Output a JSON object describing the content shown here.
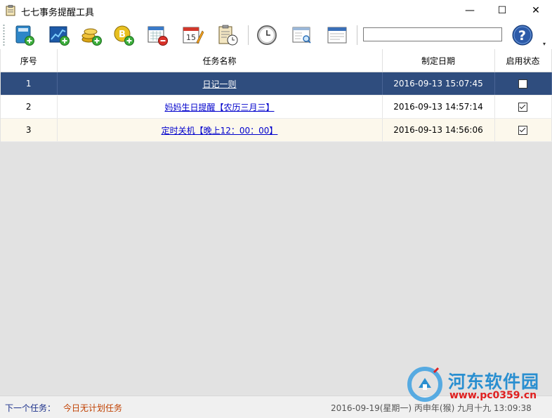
{
  "window": {
    "title": "七七事务提醒工具",
    "minimize_glyph": "—",
    "maximize_glyph": "☐",
    "close_glyph": "✕"
  },
  "toolbar": {
    "buttons": [
      {
        "icon": "add-notebook-icon"
      },
      {
        "icon": "add-chart-icon"
      },
      {
        "icon": "add-coins-icon"
      },
      {
        "icon": "add-bitcoin-icon"
      },
      {
        "icon": "remove-calendar-icon"
      },
      {
        "icon": "calendar-edit-icon"
      },
      {
        "icon": "clipboard-clock-icon"
      },
      {
        "icon": "clock-icon"
      },
      {
        "icon": "window-search-icon"
      },
      {
        "icon": "window-icon"
      },
      {
        "icon": "help-icon"
      }
    ],
    "search_value": "",
    "overflow_glyph": "▾"
  },
  "table": {
    "headers": [
      "序号",
      "任务名称",
      "制定日期",
      "启用状态"
    ],
    "rows": [
      {
        "no": "1",
        "name": "日记一则",
        "date": "2016-09-13 15:07:45",
        "enabled": false
      },
      {
        "no": "2",
        "name": "妈妈生日提醒【农历三月三】",
        "date": "2016-09-13 14:57:14",
        "enabled": true
      },
      {
        "no": "3",
        "name": "定时关机【晚上12：00：00】",
        "date": "2016-09-13 14:56:06",
        "enabled": true
      }
    ]
  },
  "status": {
    "next_task_label": "下一个任务：",
    "next_task_value": "今日无计划任务",
    "datetime": "2016-09-19(星期一)  丙申年(猴) 九月十九  13:09:38"
  },
  "watermark": {
    "text": "河东软件园",
    "url": "www.pc0359.cn"
  },
  "colors": {
    "selected_row": "#2f4d7e",
    "alt_row": "#fcf8ec",
    "link": "#0000cc",
    "status_label": "#1a2f8a",
    "status_value": "#c04000"
  }
}
